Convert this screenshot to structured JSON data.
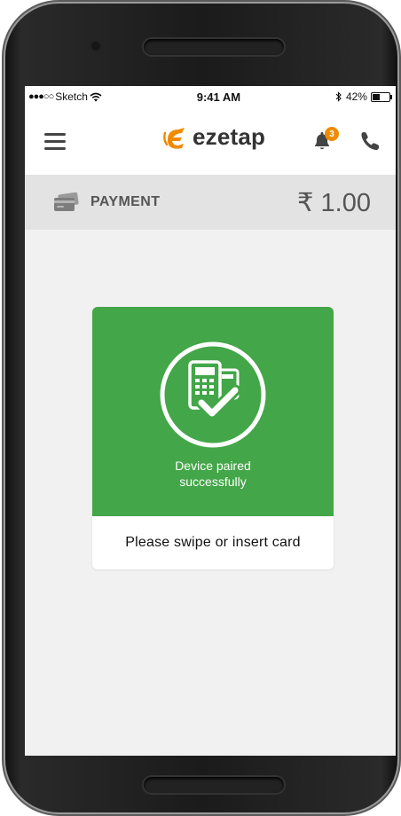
{
  "status_bar": {
    "carrier": "Sketch",
    "time": "9:41 AM",
    "battery": "42%"
  },
  "app_bar": {
    "logo_text": "ezetap",
    "notification_count": "3"
  },
  "payment_bar": {
    "label": "PAYMENT",
    "amount": "₹ 1.00"
  },
  "status_card": {
    "message": "Device paired successfully",
    "instruction": "Please swipe or insert card"
  },
  "colors": {
    "accent_orange": "#f08a00",
    "success_green": "#43a648"
  }
}
